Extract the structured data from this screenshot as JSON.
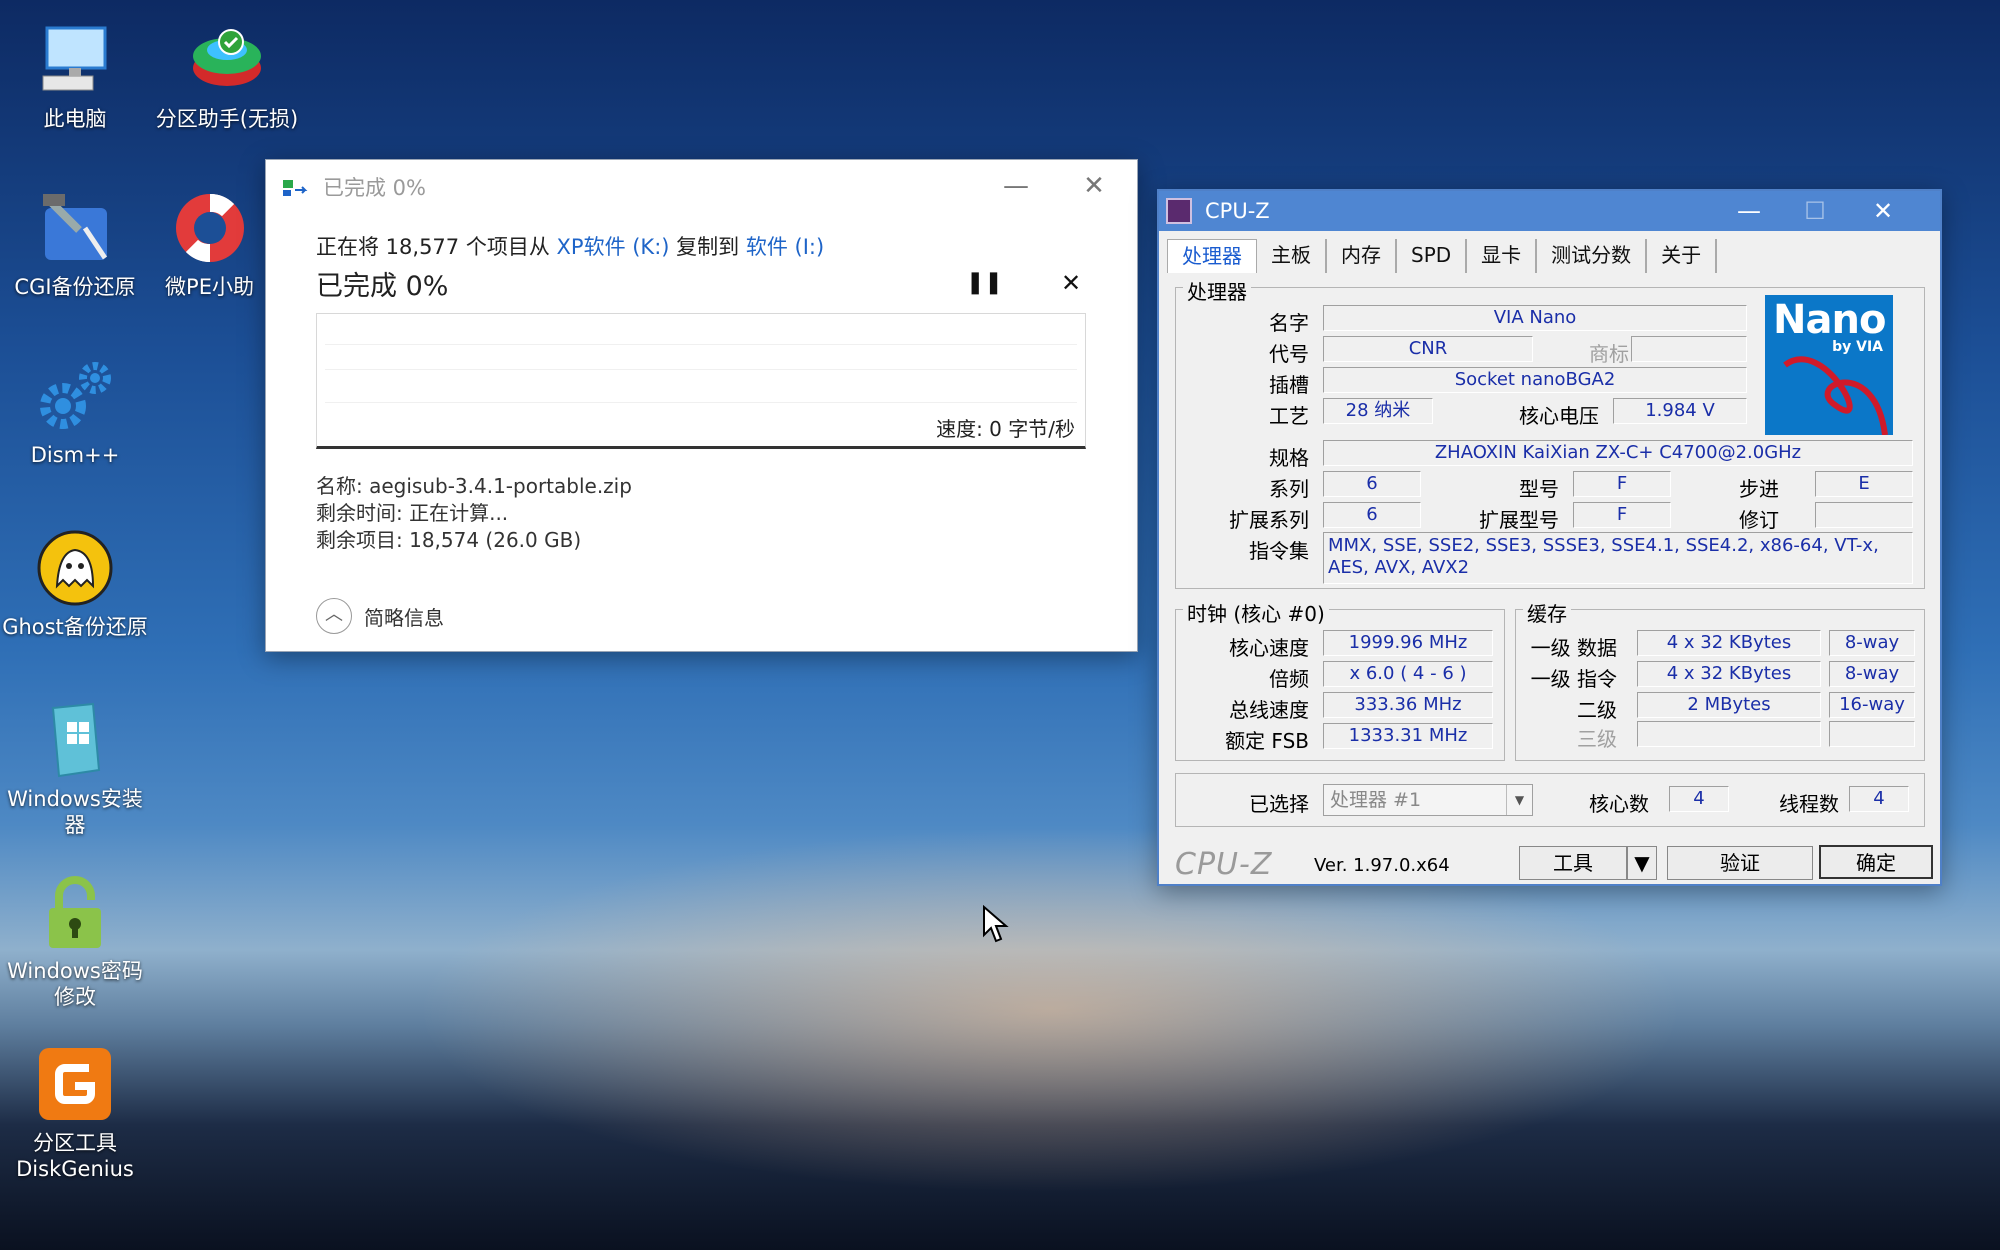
{
  "desktop": {
    "icons": [
      {
        "label": "此电脑",
        "icon": "computer-icon"
      },
      {
        "label": "分区助手(无损)",
        "icon": "partition-assistant-icon"
      },
      {
        "label": "CGI备份还原",
        "icon": "cgi-backup-icon"
      },
      {
        "label": "微PE小助",
        "icon": "lifebuoy-icon"
      },
      {
        "label": "Dism++",
        "icon": "gears-icon"
      },
      {
        "label": "Ghost备份还原",
        "icon": "ghost-icon"
      },
      {
        "label": "Windows安装器",
        "icon": "windows-installer-icon"
      },
      {
        "label": "Windows密码修改",
        "icon": "padlock-icon"
      },
      {
        "label": "分区工具DiskGenius",
        "icon": "diskgenius-icon"
      }
    ]
  },
  "copy_dialog": {
    "title": "已完成 0%",
    "line_prefix": "正在将 18,577 个项目从 ",
    "source": "XP软件 (K:)",
    "line_mid": " 复制到 ",
    "destination": "软件 (I:)",
    "heading": "已完成 0%",
    "pause_symbol": "❚❚",
    "cancel_symbol": "✕",
    "progress_fraction": 0,
    "speed": "速度: 0 字节/秒",
    "name_line": "名称: aegisub-3.4.1-portable.zip",
    "time_line": "剩余时间: 正在计算...",
    "items_line": "剩余项目: 18,574 (26.0 GB)",
    "brief_label": "简略信息",
    "minimize": "—",
    "close": "✕"
  },
  "cpuz": {
    "title": "CPU-Z",
    "tabs": [
      "处理器",
      "主板",
      "内存",
      "SPD",
      "显卡",
      "测试分数",
      "关于"
    ],
    "processor_group": "处理器",
    "labels": {
      "name": "名字",
      "codename": "代号",
      "trademark": "商标",
      "package": "插槽",
      "technology": "工艺",
      "core_voltage": "核心电压",
      "specification": "规格",
      "family": "系列",
      "model": "型号",
      "stepping": "步进",
      "ext_family": "扩展系列",
      "ext_model": "扩展型号",
      "revision": "修订",
      "instructions": "指令集"
    },
    "values": {
      "name": "VIA Nano",
      "codename": "CNR",
      "trademark": "",
      "package": "Socket nanoBGA2",
      "technology": "28 纳米",
      "core_voltage": "1.984 V",
      "specification": "ZHAOXIN KaiXian ZX-C+ C4700@2.0GHz",
      "family": "6",
      "model": "F",
      "stepping": "E",
      "ext_family": "6",
      "ext_model": "F",
      "revision": "",
      "instructions": "MMX, SSE, SSE2, SSE3, SSSE3, SSE4.1, SSE4.2, x86-64, VT-x, AES, AVX, AVX2"
    },
    "brand_logo": {
      "main": "Nano",
      "sub": "by VIA"
    },
    "clocks": {
      "group": "时钟 (核心 #0)",
      "core_speed_label": "核心速度",
      "core_speed": "1999.96 MHz",
      "multiplier_label": "倍频",
      "multiplier": "x 6.0 ( 4 - 6 )",
      "bus_speed_label": "总线速度",
      "bus_speed": "333.36 MHz",
      "rated_fsb_label": "额定 FSB",
      "rated_fsb": "1333.31 MHz"
    },
    "cache": {
      "group": "缓存",
      "l1d_label": "一级 数据",
      "l1d": "4 x 32 KBytes",
      "l1d_way": "8-way",
      "l1i_label": "一级 指令",
      "l1i": "4 x 32 KBytes",
      "l1i_way": "8-way",
      "l2_label": "二级",
      "l2": "2 MBytes",
      "l2_way": "16-way",
      "l3_label": "三级",
      "l3": "",
      "l3_way": ""
    },
    "selection": {
      "label": "已选择",
      "value": "处理器 #1",
      "cores_label": "核心数",
      "cores": "4",
      "threads_label": "线程数",
      "threads": "4"
    },
    "footer": {
      "logo": "CPU-Z",
      "version": "Ver. 1.97.0.x64",
      "tools": "工具",
      "validate": "验证",
      "ok": "确定"
    },
    "title_buttons": {
      "minimize": "—",
      "maximize": "☐",
      "close": "✕"
    }
  }
}
